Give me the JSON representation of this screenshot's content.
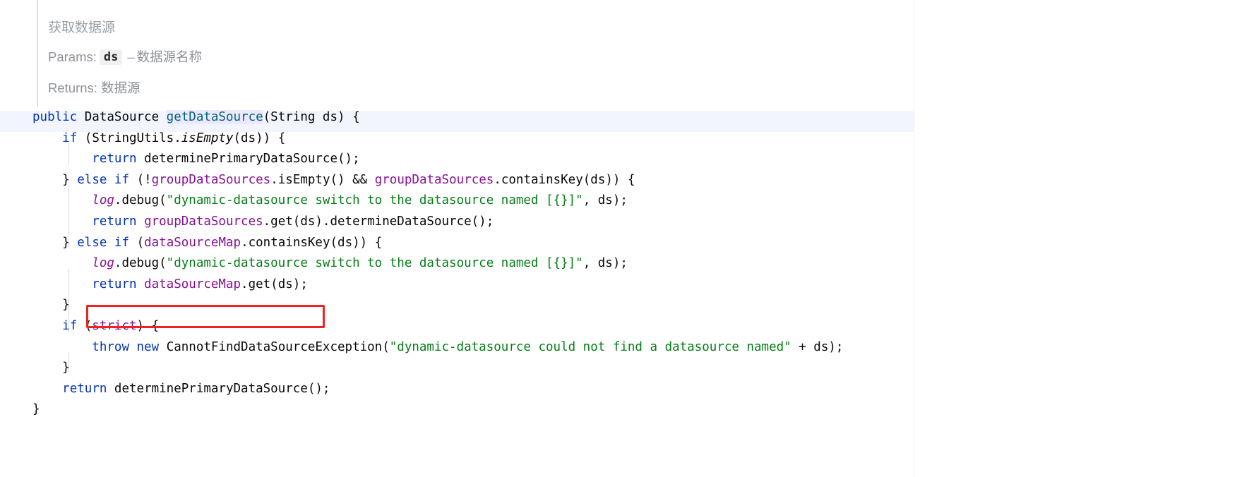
{
  "doc": {
    "summary": "获取数据源",
    "params_label": "Params:",
    "param_name": "ds",
    "param_dash": "–",
    "param_desc": "数据源名称",
    "returns_label": "Returns:",
    "returns_value": "数据源"
  },
  "code": {
    "language": "java",
    "signature": "public DataSource getDataSource(String ds) {",
    "highlighted_method": "getDataSource",
    "lines": [
      "public DataSource getDataSource(String ds) {",
      "    if (StringUtils.isEmpty(ds)) {",
      "        return determinePrimaryDataSource();",
      "    } else if (!groupDataSources.isEmpty() && groupDataSources.containsKey(ds)) {",
      "        log.debug(\"dynamic-datasource switch to the datasource named [{}]\", ds);",
      "        return groupDataSources.get(ds).determineDataSource();",
      "    } else if (dataSourceMap.containsKey(ds)) {",
      "        log.debug(\"dynamic-datasource switch to the datasource named [{}]\", ds);",
      "        return dataSourceMap.get(ds);",
      "    }",
      "    if (strict) {",
      "        throw new CannotFindDataSourceException(\"dynamic-datasource could not find a datasource named\" + ds);",
      "    }",
      "    return determinePrimaryDataSource();",
      "}"
    ],
    "keywords": [
      "public",
      "if",
      "return",
      "else",
      "new",
      "throw"
    ],
    "fields": [
      "groupDataSources",
      "dataSourceMap",
      "strict",
      "log"
    ],
    "strings": [
      "\"dynamic-datasource switch to the datasource named [{}]\"",
      "\"dynamic-datasource could not find a datasource named\""
    ],
    "types": [
      "DataSource",
      "String",
      "StringUtils",
      "CannotFindDataSourceException"
    ],
    "methods": [
      "getDataSource",
      "isEmpty",
      "determinePrimaryDataSource",
      "containsKey",
      "debug",
      "get",
      "determineDataSource"
    ]
  },
  "annotation": {
    "type": "red-rectangle",
    "color": "#ee2222",
    "target_text": "return dataSourceMap.get(ds);"
  },
  "colors": {
    "keyword": "#0033b3",
    "field": "#871094",
    "string": "#067d17",
    "method": "#00627a",
    "method_highlight_bg": "#ece9fc",
    "signature_line_bg": "#f2f5fd",
    "doc_text": "#8e9297",
    "annotation_red": "#ee2222",
    "background": "#ffffff"
  }
}
